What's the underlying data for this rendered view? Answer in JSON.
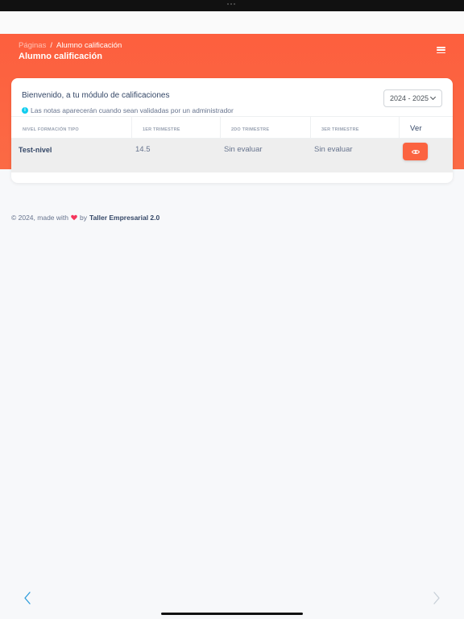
{
  "breadcrumb": {
    "root": "Páginas",
    "separator": "/",
    "current": "Alumno calificación"
  },
  "page": {
    "title": "Alumno calificación"
  },
  "card": {
    "heading": "Bienvenido, a tu módulo de calificaciones",
    "info": "Las notas aparecerán cuando sean validadas por un administrador",
    "year_selected": "2024 - 2025"
  },
  "table": {
    "headers": [
      "NIVEL FORMACIÓN TIPO",
      "1ER TRIMESTRE",
      "2DO TRIMESTRE",
      "3ER TRIMESTRE",
      "Ver"
    ],
    "rows": [
      {
        "nivel": "Test-nivel",
        "t1": "14.5",
        "t2": "Sin evaluar",
        "t3": "Sin evaluar"
      }
    ]
  },
  "footer": {
    "prefix": "© 2024, made with",
    "by": "by",
    "brand": "Taller Empresarial 2.0"
  },
  "colors": {
    "accent": "#fb6340",
    "info": "#11cdef",
    "nav": "#2d9cdb"
  },
  "icons": {
    "menu": "hamburger-icon",
    "info": "info-icon",
    "view": "eye-icon",
    "heart": "heart-icon",
    "back": "chevron-left-icon",
    "forward": "chevron-right-icon",
    "select": "chevron-down-icon"
  }
}
